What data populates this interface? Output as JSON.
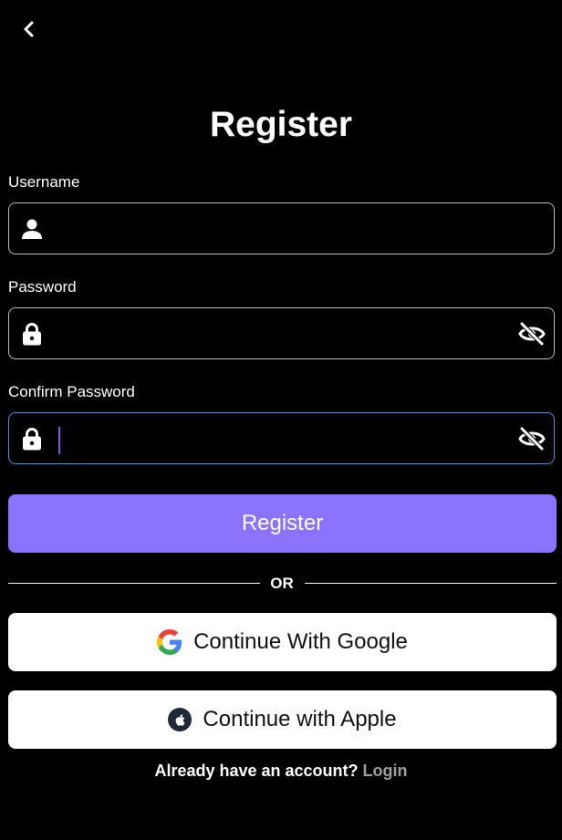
{
  "header": {
    "back_icon": "chevron-left-icon",
    "title": "Register"
  },
  "form": {
    "username": {
      "label": "Username",
      "value": "",
      "icon": "person-icon"
    },
    "password": {
      "label": "Password",
      "value": "",
      "icon": "lock-icon",
      "toggle_icon": "eye-off-icon"
    },
    "confirm_password": {
      "label": "Confirm Password",
      "value": "",
      "icon": "lock-icon",
      "toggle_icon": "eye-off-icon",
      "focused": true
    }
  },
  "register_button": {
    "label": "Register"
  },
  "separator": {
    "text": "OR"
  },
  "social": {
    "google_label": "Continue With Google",
    "google_icon": "google-icon",
    "apple_label": "Continue with Apple",
    "apple_icon": "apple-icon"
  },
  "footer": {
    "question": "Already have an account?",
    "login_link": "Login"
  },
  "colors": {
    "background": "#000000",
    "primary": "#8b73ff",
    "focus_border": "#4e8fe6",
    "field_border": "#bdbdbd",
    "muted_link": "#9e9e9e"
  }
}
